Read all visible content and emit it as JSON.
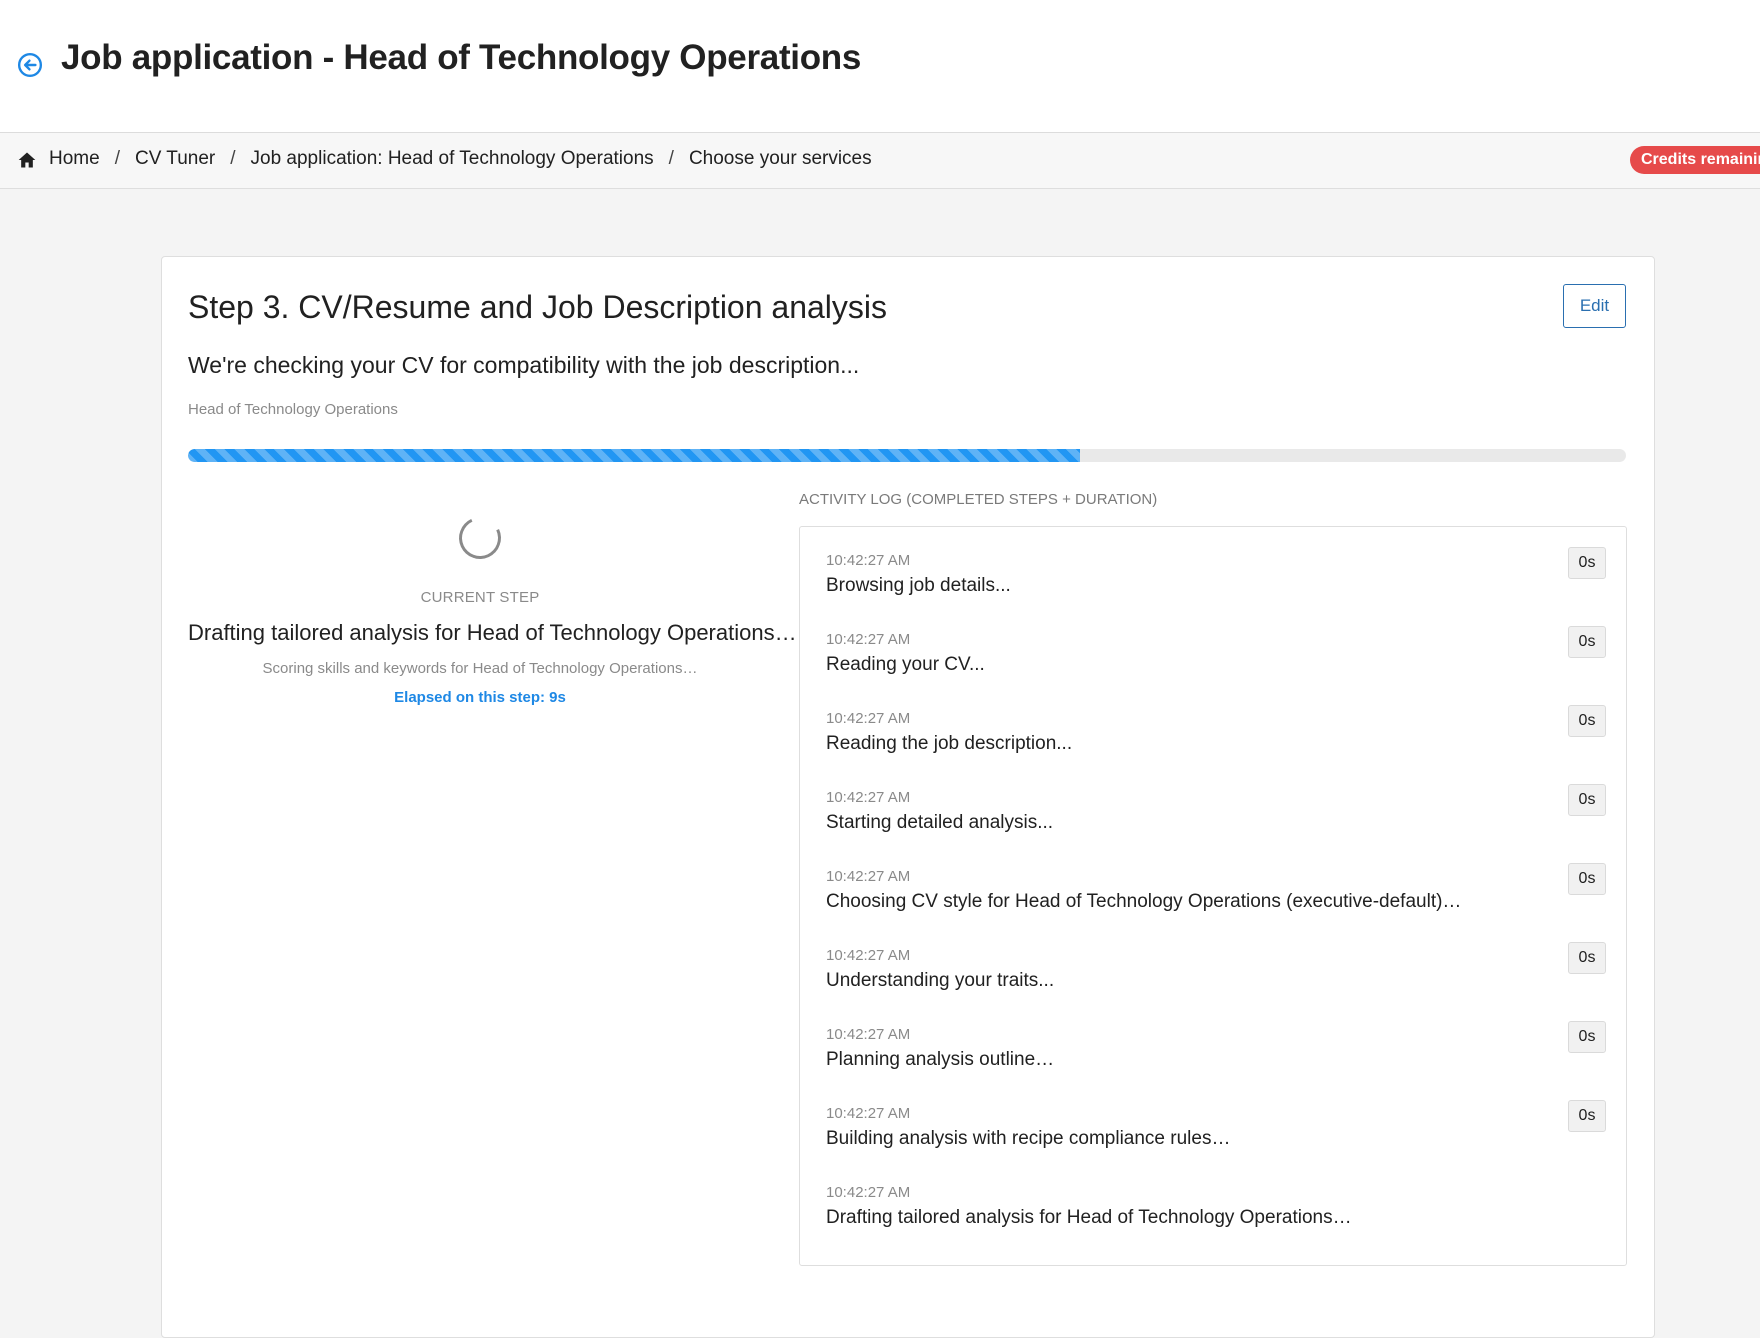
{
  "header": {
    "title": "Job application - Head of Technology Operations",
    "back_icon": "back-arrow-circle-icon"
  },
  "breadcrumb": {
    "home_icon": "home-icon",
    "items": [
      "Home",
      "CV Tuner",
      "Job application: Head of Technology Operations",
      "Choose your services"
    ],
    "separator": "/"
  },
  "credits_badge": {
    "label": "Credits remaining",
    "color": "#e64a4a"
  },
  "step": {
    "title": "Step 3. CV/Resume and Job Description analysis",
    "edit_label": "Edit",
    "subtitle": "We're checking your CV for compatibility with the job description...",
    "job_label": "Head of Technology Operations",
    "progress_percent": 62
  },
  "current_step": {
    "label": "CURRENT STEP",
    "text": "Drafting tailored analysis for Head of Technology Operations…",
    "sub_text": "Scoring skills and keywords for Head of Technology Operations…",
    "elapsed": "Elapsed on this step: 9s"
  },
  "activity_log": {
    "heading": "ACTIVITY LOG (COMPLETED STEPS + DURATION)",
    "entries": [
      {
        "time": "10:42:27 AM",
        "text": "Browsing job details...",
        "duration": "0s"
      },
      {
        "time": "10:42:27 AM",
        "text": "Reading your CV...",
        "duration": "0s"
      },
      {
        "time": "10:42:27 AM",
        "text": "Reading the job description...",
        "duration": "0s"
      },
      {
        "time": "10:42:27 AM",
        "text": "Starting detailed analysis...",
        "duration": "0s"
      },
      {
        "time": "10:42:27 AM",
        "text": "Choosing CV style for Head of Technology Operations (executive-default)…",
        "duration": "0s"
      },
      {
        "time": "10:42:27 AM",
        "text": "Understanding your traits...",
        "duration": "0s"
      },
      {
        "time": "10:42:27 AM",
        "text": "Planning analysis outline…",
        "duration": "0s"
      },
      {
        "time": "10:42:27 AM",
        "text": "Building analysis with recipe compliance rules…",
        "duration": "0s"
      },
      {
        "time": "10:42:27 AM",
        "text": "Drafting tailored analysis for Head of Technology Operations…",
        "duration": ""
      }
    ]
  },
  "colors": {
    "accent": "#2196f3",
    "link_blue": "#1e88e5",
    "edit_border": "#2a6fb0"
  }
}
